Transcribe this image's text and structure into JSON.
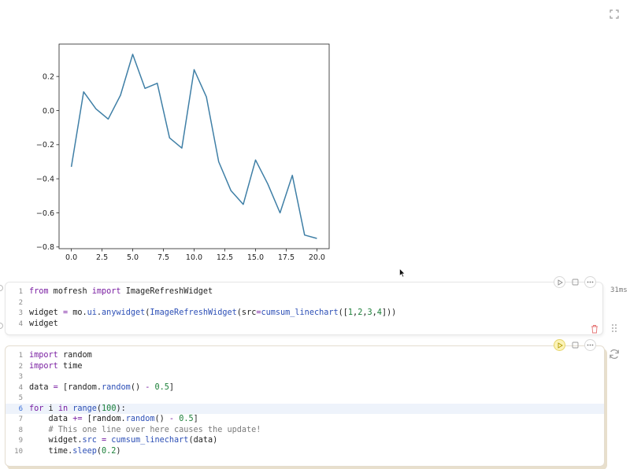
{
  "output": {
    "chart_data": {
      "type": "line",
      "x": [
        0,
        1,
        2,
        3,
        4,
        5,
        6,
        7,
        8,
        9,
        10,
        11,
        12,
        13,
        14,
        15,
        16,
        17,
        18,
        19,
        20
      ],
      "series": [
        {
          "values": [
            -0.33,
            0.11,
            0.01,
            -0.05,
            0.09,
            0.33,
            0.13,
            0.16,
            -0.16,
            -0.22,
            0.24,
            0.08,
            -0.3,
            -0.47,
            -0.55,
            -0.29,
            -0.43,
            -0.6,
            -0.38,
            -0.73,
            -0.75
          ]
        }
      ],
      "xlim": [
        -1,
        21
      ],
      "ylim": [
        -0.81,
        0.39
      ],
      "x_ticks": [
        0,
        2.5,
        5,
        7.5,
        10,
        12.5,
        15,
        17.5,
        20
      ],
      "x_tick_labels": [
        "0.0",
        "2.5",
        "5.0",
        "7.5",
        "10.0",
        "12.5",
        "15.0",
        "17.5",
        "20.0"
      ],
      "y_ticks": [
        -0.8,
        -0.6,
        -0.4,
        -0.2,
        0.0,
        0.2
      ],
      "y_tick_labels": [
        "−0.8",
        "−0.6",
        "−0.4",
        "−0.2",
        "0.0",
        "0.2"
      ],
      "title": "",
      "xlabel": "",
      "ylabel": "",
      "grid": false,
      "line_color": "#3f7fa6"
    }
  },
  "cell1": {
    "timing": "31ms",
    "lines": [
      {
        "n": "1",
        "tokens": [
          {
            "t": "from",
            "c": "kw"
          },
          {
            "t": " mofresh ",
            "c": ""
          },
          {
            "t": "import",
            "c": "kw"
          },
          {
            "t": " ImageRefreshWidget",
            "c": ""
          }
        ]
      },
      {
        "n": "2",
        "tokens": []
      },
      {
        "n": "3",
        "tokens": [
          {
            "t": "widget ",
            "c": ""
          },
          {
            "t": "=",
            "c": "op"
          },
          {
            "t": " mo.",
            "c": ""
          },
          {
            "t": "ui",
            "c": "attr"
          },
          {
            "t": ".",
            "c": ""
          },
          {
            "t": "anywidget",
            "c": "fn"
          },
          {
            "t": "(",
            "c": ""
          },
          {
            "t": "ImageRefreshWidget",
            "c": "fn"
          },
          {
            "t": "(src",
            "c": ""
          },
          {
            "t": "=",
            "c": "op"
          },
          {
            "t": "cumsum_linechart",
            "c": "fn"
          },
          {
            "t": "([",
            "c": ""
          },
          {
            "t": "1",
            "c": "num"
          },
          {
            "t": ",",
            "c": ""
          },
          {
            "t": "2",
            "c": "num"
          },
          {
            "t": ",",
            "c": ""
          },
          {
            "t": "3",
            "c": "num"
          },
          {
            "t": ",",
            "c": ""
          },
          {
            "t": "4",
            "c": "num"
          },
          {
            "t": "]))",
            "c": ""
          }
        ]
      },
      {
        "n": "4",
        "tokens": [
          {
            "t": "widget",
            "c": ""
          }
        ]
      }
    ]
  },
  "cell2": {
    "lines": [
      {
        "n": "1",
        "tokens": [
          {
            "t": "import",
            "c": "kw"
          },
          {
            "t": " random",
            "c": ""
          }
        ]
      },
      {
        "n": "2",
        "tokens": [
          {
            "t": "import",
            "c": "kw"
          },
          {
            "t": " time",
            "c": ""
          }
        ]
      },
      {
        "n": "3",
        "tokens": []
      },
      {
        "n": "4",
        "tokens": [
          {
            "t": "data ",
            "c": ""
          },
          {
            "t": "=",
            "c": "op"
          },
          {
            "t": " [random.",
            "c": ""
          },
          {
            "t": "random",
            "c": "fn"
          },
          {
            "t": "() ",
            "c": ""
          },
          {
            "t": "-",
            "c": "op"
          },
          {
            "t": " ",
            "c": ""
          },
          {
            "t": "0.5",
            "c": "num"
          },
          {
            "t": "]",
            "c": ""
          }
        ]
      },
      {
        "n": "5",
        "tokens": []
      },
      {
        "n": "6",
        "active": true,
        "tokens": [
          {
            "t": "for",
            "c": "kw"
          },
          {
            "t": " i ",
            "c": ""
          },
          {
            "t": "in",
            "c": "kw"
          },
          {
            "t": " ",
            "c": ""
          },
          {
            "t": "range",
            "c": "fn"
          },
          {
            "t": "(",
            "c": ""
          },
          {
            "t": "100",
            "c": "num"
          },
          {
            "t": "):",
            "c": ""
          }
        ]
      },
      {
        "n": "7",
        "tokens": [
          {
            "t": "    data ",
            "c": ""
          },
          {
            "t": "+=",
            "c": "op"
          },
          {
            "t": " [random.",
            "c": ""
          },
          {
            "t": "random",
            "c": "fn"
          },
          {
            "t": "() ",
            "c": ""
          },
          {
            "t": "-",
            "c": "op"
          },
          {
            "t": " ",
            "c": ""
          },
          {
            "t": "0.5",
            "c": "num"
          },
          {
            "t": "]",
            "c": ""
          }
        ]
      },
      {
        "n": "8",
        "tokens": [
          {
            "t": "    # This one line over here causes the update!",
            "c": "cm"
          }
        ]
      },
      {
        "n": "9",
        "tokens": [
          {
            "t": "    widget.",
            "c": ""
          },
          {
            "t": "src",
            "c": "attr"
          },
          {
            "t": " ",
            "c": ""
          },
          {
            "t": "=",
            "c": "op"
          },
          {
            "t": " ",
            "c": ""
          },
          {
            "t": "cumsum_linechart",
            "c": "fn"
          },
          {
            "t": "(data)",
            "c": ""
          }
        ]
      },
      {
        "n": "10",
        "tokens": [
          {
            "t": "    time.",
            "c": ""
          },
          {
            "t": "sleep",
            "c": "fn"
          },
          {
            "t": "(",
            "c": ""
          },
          {
            "t": "0.2",
            "c": "num"
          },
          {
            "t": ")",
            "c": ""
          }
        ]
      }
    ]
  },
  "icons": {
    "expand": "expand-icon",
    "run": "play-icon",
    "stop": "stop-icon",
    "more": "ellipsis-icon",
    "delete": "trash-icon",
    "drag": "drag-handle-icon",
    "refresh": "refresh-icon"
  }
}
